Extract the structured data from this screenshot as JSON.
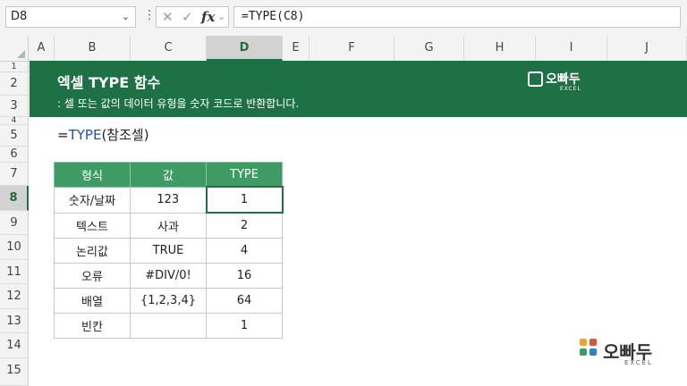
{
  "formula_bar": {
    "name_box": "D8",
    "dropdown_glyph": "⌄",
    "dots_glyph": "⋮",
    "cancel_glyph": "✕",
    "enter_glyph": "✓",
    "fx_glyph": "fx",
    "fx_dropdown_glyph": "⌄",
    "formula": "=TYPE(C8)"
  },
  "columns": [
    "A",
    "B",
    "C",
    "D",
    "E",
    "F",
    "G",
    "H",
    "I",
    "J"
  ],
  "rows": [
    "1",
    "2",
    "3",
    "4",
    "5",
    "6",
    "7",
    "8",
    "9",
    "10",
    "11",
    "12",
    "13",
    "14",
    "15"
  ],
  "selected_cell": {
    "column": "D",
    "row": "8"
  },
  "banner": {
    "title": "엑셀 TYPE 함수",
    "subtitle": ": 셀 또는 값의 데이터 유형을 숫자 코드로 반환합니다.",
    "brand_name": "오빠두",
    "brand_sub": "EXCEL"
  },
  "formula_text": {
    "prefix": "=",
    "function": "TYPE",
    "args": "(참조셀)"
  },
  "table": {
    "headers": [
      "형식",
      "값",
      "TYPE"
    ],
    "rows": [
      [
        "숫자/날짜",
        "123",
        "1"
      ],
      [
        "텍스트",
        "사과",
        "2"
      ],
      [
        "논리값",
        "TRUE",
        "4"
      ],
      [
        "오류",
        "#DIV/0!",
        "16"
      ],
      [
        "배열",
        "{1,2,3,4}",
        "64"
      ],
      [
        "빈칸",
        "",
        "1"
      ]
    ]
  },
  "footer_brand": {
    "name": "오빠두",
    "sub": "EXCEL"
  },
  "colors": {
    "banner": "#1e7145",
    "table_header": "#3d9b63",
    "function_text": "#1f4fbf",
    "selection": "#1e7145"
  }
}
